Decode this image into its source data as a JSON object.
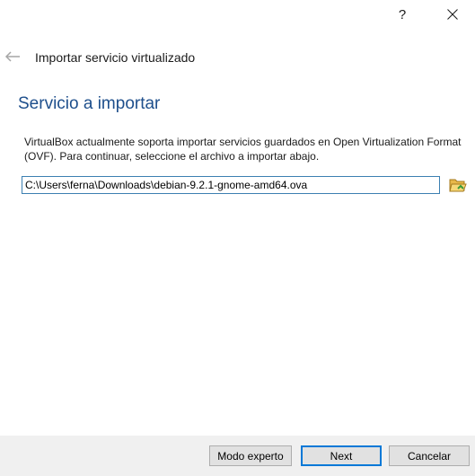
{
  "titlebar": {
    "help_label": "?",
    "close_icon": "close-icon"
  },
  "wizard": {
    "title": "Importar servicio virtualizado",
    "back_icon": "back-arrow-icon"
  },
  "page": {
    "heading": "Servicio a importar",
    "description": "VirtualBox actualmente soporta importar servicios guardados en Open Virtualization Format (OVF). Para continuar, seleccione el archivo a importar abajo."
  },
  "file_picker": {
    "value": "C:\\Users\\ferna\\Downloads\\debian-9.2.1-gnome-amd64.ova",
    "browse_icon": "folder-open-icon"
  },
  "buttons": {
    "expert_label": "Modo experto",
    "next_label": "Next",
    "cancel_label": "Cancelar"
  },
  "colors": {
    "heading": "#1e4f8c",
    "input_border": "#3c7fb1",
    "default_button_border": "#0078d7",
    "bottom_bar": "#f0f0f0"
  }
}
